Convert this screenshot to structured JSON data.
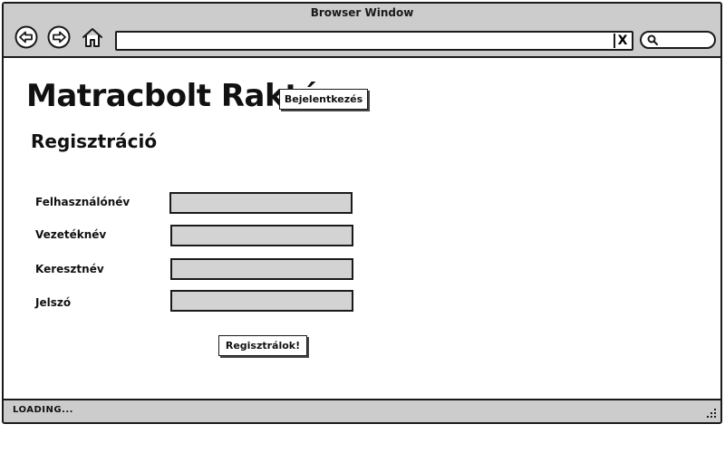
{
  "window": {
    "title": "Browser Window"
  },
  "address_bar": {
    "value": "",
    "clear_label": "X"
  },
  "search": {
    "value": ""
  },
  "header": {
    "app_title": "Matracbolt Raktár",
    "login_label": "Bejelentkezés"
  },
  "registration": {
    "title": "Regisztráció",
    "fields": [
      {
        "label": "Felhasználónév",
        "value": ""
      },
      {
        "label": "Vezetéknév",
        "value": ""
      },
      {
        "label": "Keresztnév",
        "value": ""
      },
      {
        "label": "Jelszó",
        "value": ""
      }
    ],
    "submit_label": "Regisztrálok!"
  },
  "status_bar": {
    "text": "LOADING..."
  },
  "colors": {
    "chrome": "#cccccc",
    "input_fill": "#d3d3d3",
    "border": "#1a1a1a"
  }
}
